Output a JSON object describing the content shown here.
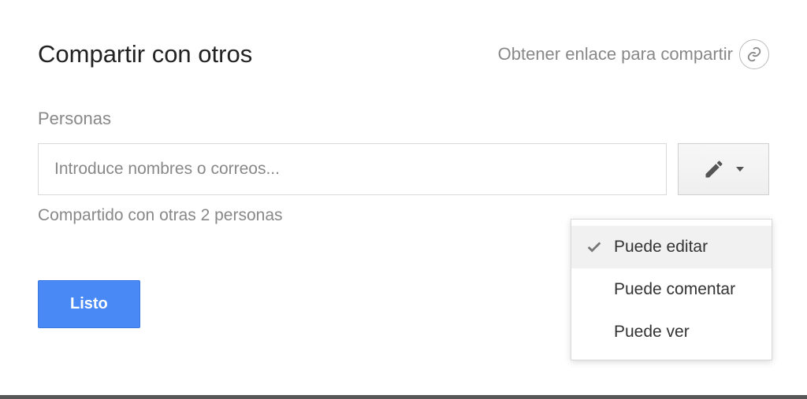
{
  "header": {
    "title": "Compartir con otros",
    "shareLinkText": "Obtener enlace para compartir"
  },
  "peopleSection": {
    "label": "Personas",
    "placeholder": "Introduce nombres o correos..."
  },
  "sharedWithText": "Compartido con otras 2 personas",
  "doneButton": "Listo",
  "permissionOptions": {
    "edit": "Puede editar",
    "comment": "Puede comentar",
    "view": "Puede ver"
  }
}
